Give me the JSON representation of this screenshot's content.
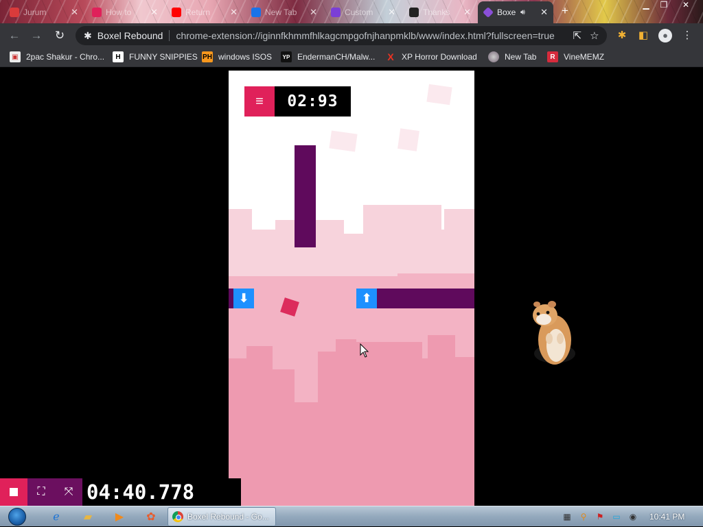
{
  "tabs": [
    {
      "label": "Jurum",
      "active": false
    },
    {
      "label": "How to",
      "active": false
    },
    {
      "label": "Return",
      "active": false
    },
    {
      "label": "New Tab",
      "active": false
    },
    {
      "label": "Custom",
      "active": false
    },
    {
      "label": "Thanks",
      "active": false
    },
    {
      "label": "Boxe",
      "active": true
    }
  ],
  "toolbar": {
    "site_title": "Boxel Rebound",
    "url": "chrome-extension://iginnfkhmmfhlkagcmpgofnjhanpmklb/www/index.html?fullscreen=true"
  },
  "bookmarks": [
    {
      "label": "2pac Shakur - Chro...",
      "icon": "H"
    },
    {
      "label": "FUNNY SNIPPIES",
      "icon": "H"
    },
    {
      "label": "windows ISOS",
      "icon": "PH"
    },
    {
      "label": "EndermanCH/Malw...",
      "icon": "YP"
    },
    {
      "label": "XP Horror Download",
      "icon": "X"
    },
    {
      "label": "New Tab",
      "icon": "globe"
    },
    {
      "label": "VineMEMZ",
      "icon": "R"
    }
  ],
  "game": {
    "menu_icon": "≡",
    "level_timer": "02:93",
    "speedrun_timer": "04:40.778"
  },
  "taskbar": {
    "active_window": "Boxel Rebound - Go...",
    "clock": "10:41 PM"
  },
  "colors": {
    "accent_pink": "#e0215a",
    "pillar_purple": "#5f0a5c",
    "pad_blue": "#1e90ff",
    "player": "#dc2c5c"
  }
}
